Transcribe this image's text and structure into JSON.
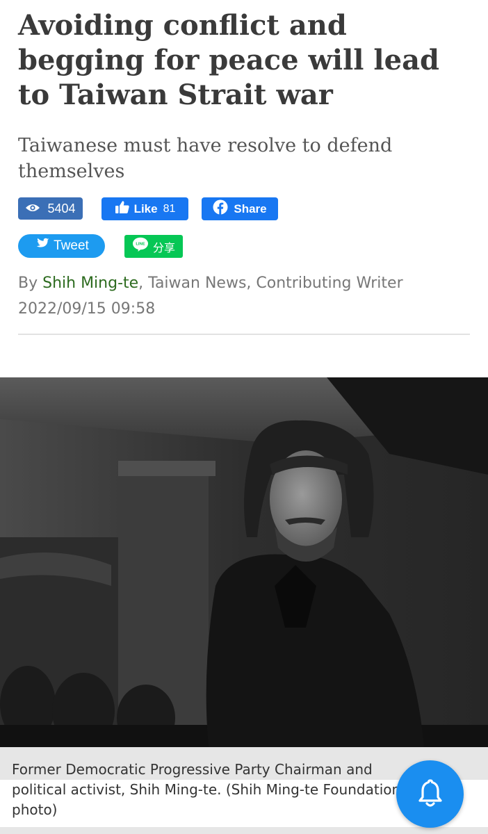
{
  "article": {
    "headline": "Avoiding conflict and begging for peace will lead to Taiwan Strait war",
    "subheadline": "Taiwanese must have resolve to defend themselves",
    "byline_prefix": "By ",
    "author": "Shih Ming-te",
    "byline_suffix": ", Taiwan News, Contributing Writer",
    "date": "2022/09/15 09:58"
  },
  "social": {
    "views": "5404",
    "like_label": "Like",
    "like_count": "81",
    "share_label": "Share",
    "tweet_label": "Tweet",
    "line_badge": "LINE",
    "line_label": "分享"
  },
  "photo": {
    "caption": "Former Democratic Progressive Party Chairman and political activist, Shih Ming-te. (Shih Ming-te Foundation photo)"
  },
  "icons": {
    "views": "eye-icon",
    "like": "thumbs-up-icon",
    "share": "facebook-icon",
    "tweet": "twitter-bird-icon",
    "line": "line-icon",
    "notifications": "bell-icon"
  },
  "colors": {
    "views_bg": "#3b6fb6",
    "facebook": "#1877f2",
    "twitter": "#1d9bf0",
    "line": "#06c755",
    "author_link": "#2d6b1f",
    "bell_bg": "#1a8ef0"
  }
}
